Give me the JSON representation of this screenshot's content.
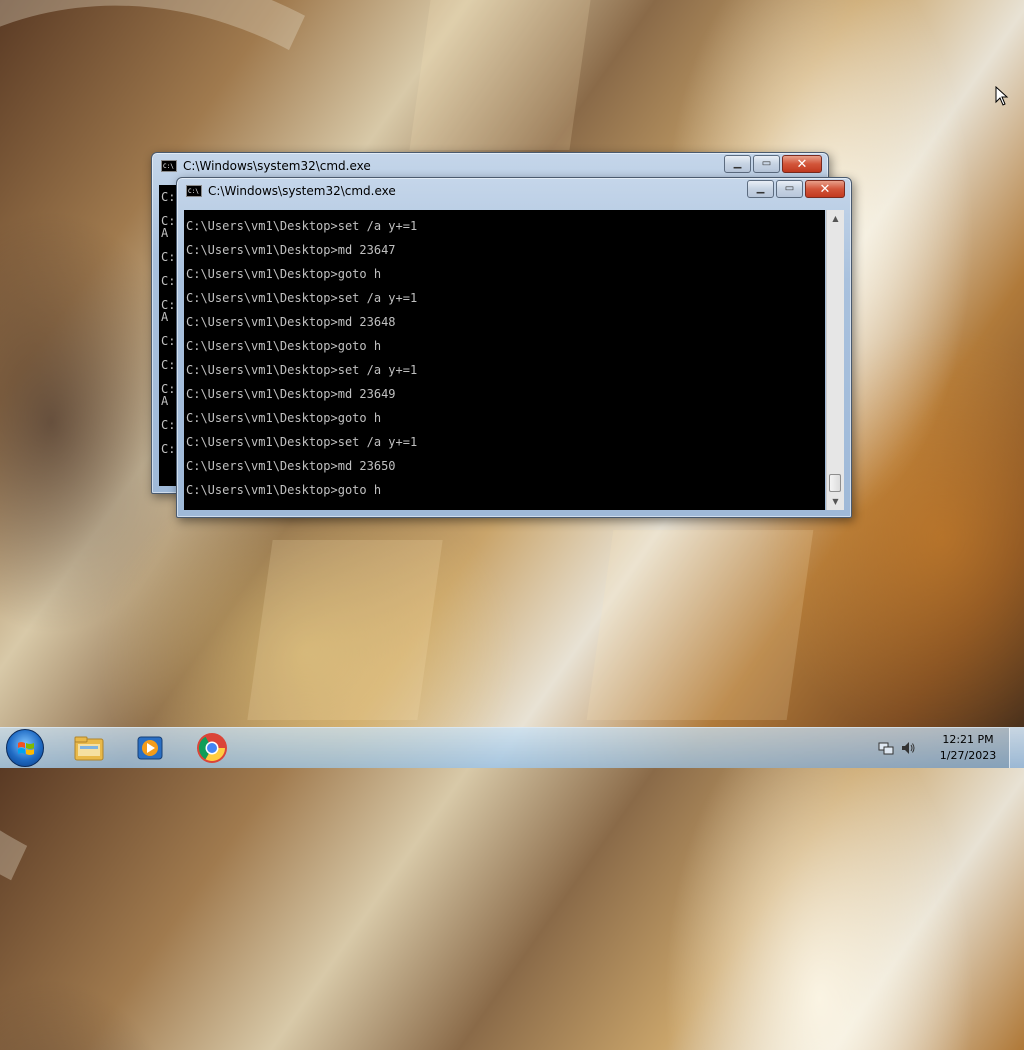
{
  "back_window": {
    "title": "C:\\Windows\\system32\\cmd.exe",
    "icon": "cmd-icon",
    "visible_fragments": [
      "C:",
      "",
      "C:",
      "A",
      "",
      "C:",
      "",
      "C:",
      "",
      "C:",
      "A",
      "",
      "C:",
      "",
      "C:",
      "",
      "C:",
      "A",
      "",
      "C:",
      "",
      "C:"
    ]
  },
  "front_window": {
    "title": "C:\\Windows\\system32\\cmd.exe",
    "icon": "cmd-icon",
    "lines": [
      "C:\\Users\\vm1\\Desktop>set /a y+=1",
      "C:\\Users\\vm1\\Desktop>md 23647",
      "C:\\Users\\vm1\\Desktop>goto h",
      "C:\\Users\\vm1\\Desktop>set /a y+=1",
      "C:\\Users\\vm1\\Desktop>md 23648",
      "C:\\Users\\vm1\\Desktop>goto h",
      "C:\\Users\\vm1\\Desktop>set /a y+=1",
      "C:\\Users\\vm1\\Desktop>md 23649",
      "C:\\Users\\vm1\\Desktop>goto h",
      "C:\\Users\\vm1\\Desktop>set /a y+=1",
      "C:\\Users\\vm1\\Desktop>md 23650",
      "C:\\Users\\vm1\\Desktop>goto h"
    ]
  },
  "window_controls": {
    "minimize": "minimize-icon",
    "maximize": "maximize-icon",
    "close": "close-icon"
  },
  "taskbar": {
    "start_icon": "windows-start-icon",
    "pinned": [
      {
        "name": "explorer",
        "icon": "folder-icon"
      },
      {
        "name": "media-player",
        "icon": "media-player-icon"
      },
      {
        "name": "chrome",
        "icon": "chrome-icon"
      }
    ],
    "tray_icons": [
      "network-icon",
      "volume-icon"
    ],
    "time": "12:21 PM",
    "date": "1/27/2023"
  },
  "colors": {
    "console_bg": "#000000",
    "console_text": "#c0c0c0",
    "close_button": "#c23a20"
  }
}
